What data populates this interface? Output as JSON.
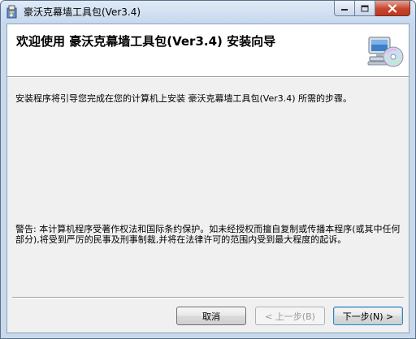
{
  "window": {
    "title": "豪沃克幕墙工具包(Ver3.4)",
    "icons": {
      "app": "installer-box-icon",
      "minimize": "minimize-icon",
      "maximize": "maximize-icon",
      "close": "close-icon"
    }
  },
  "banner": {
    "title": "欢迎使用 豪沃克幕墙工具包(Ver3.4) 安装向导",
    "icon": "computer-cd-icon"
  },
  "body": {
    "intro": "安装程序将引导您完成在您的计算机上安装 豪沃克幕墙工具包(Ver3.4) 所需的步骤。",
    "warning": "警告: 本计算机程序受著作权法和国际条约保护。如未经授权而擅自复制或传播本程序(或其中任何部分),将受到严厉的民事及刑事制裁,并将在法律许可的范围内受到最大程度的起诉。"
  },
  "buttons": {
    "cancel": "取消",
    "back": "< 上一步(B)",
    "next": "下一步(N) >"
  },
  "colors": {
    "title_bar": "#c6d8ee",
    "close_button": "#c7442d",
    "dialog_background": "#f0f0f0",
    "default_button_border": "#3c7fb1"
  }
}
